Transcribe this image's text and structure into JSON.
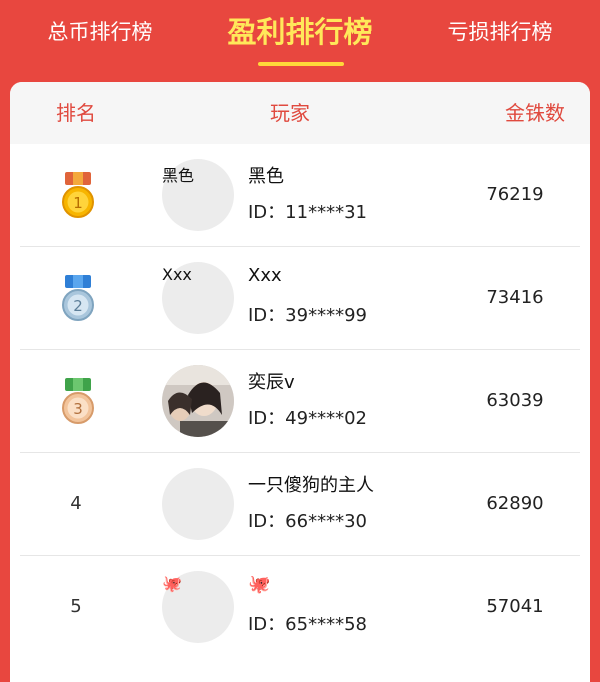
{
  "tabs": [
    {
      "label": "总币排行榜",
      "active": false
    },
    {
      "label": "盈利排行榜",
      "active": true
    },
    {
      "label": "亏损排行榜",
      "active": false
    }
  ],
  "table": {
    "headers": {
      "rank": "排名",
      "player": "玩家",
      "coins": "金铢数"
    }
  },
  "rows": [
    {
      "rank": "1",
      "medal": "gold-medal-icon",
      "avatar_label": "黑色",
      "name": "黑色",
      "id": "ID：11****31",
      "coins": "76219"
    },
    {
      "rank": "2",
      "medal": "silver-medal-icon",
      "avatar_label": "Xxx",
      "name": "Xxx",
      "id": "ID：39****99",
      "coins": "73416"
    },
    {
      "rank": "3",
      "medal": "bronze-medal-icon",
      "avatar_label": "",
      "name": "奕辰v",
      "id": "ID：49****02",
      "coins": "63039"
    },
    {
      "rank": "4",
      "medal": "",
      "avatar_label": "",
      "name": "一只傻狗的主人",
      "id": "ID：66****30",
      "coins": "62890"
    },
    {
      "rank": "5",
      "medal": "",
      "avatar_label": "🐙",
      "name": "🐙",
      "id": "ID：65****58",
      "coins": "57041"
    }
  ],
  "colors": {
    "background": "#e8473f",
    "active_tab": "#ffe85a",
    "header_text": "#e04a3f"
  }
}
